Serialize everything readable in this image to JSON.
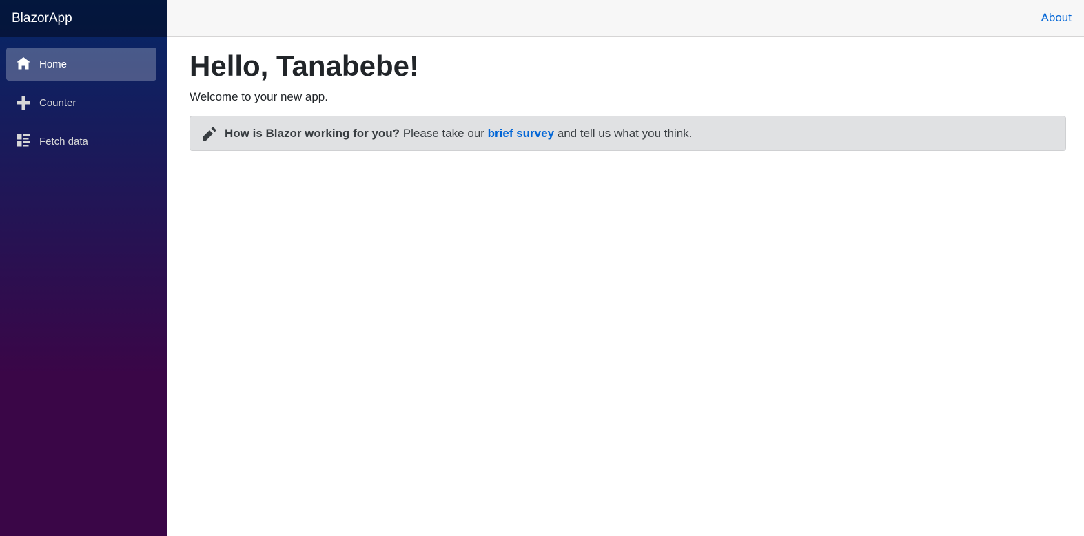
{
  "app": {
    "brand": "BlazorApp"
  },
  "sidebar": {
    "items": [
      {
        "label": "Home",
        "icon": "home-icon",
        "active": true
      },
      {
        "label": "Counter",
        "icon": "plus-icon",
        "active": false
      },
      {
        "label": "Fetch data",
        "icon": "list-rich-icon",
        "active": false
      }
    ]
  },
  "topbar": {
    "about_label": "About"
  },
  "main": {
    "title": "Hello, Tanabebe!",
    "welcome": "Welcome to your new app.",
    "survey": {
      "question": "How is Blazor working for you?",
      "before_link": " Please take our ",
      "link_label": "brief survey",
      "after_link": " and tell us what you think.",
      "icon": "pencil-icon"
    }
  },
  "colors": {
    "sidebar_gradient_top": "#052767",
    "sidebar_gradient_bottom": "#3a0647",
    "link": "#0366d6",
    "alert_background": "#e0e1e3"
  }
}
